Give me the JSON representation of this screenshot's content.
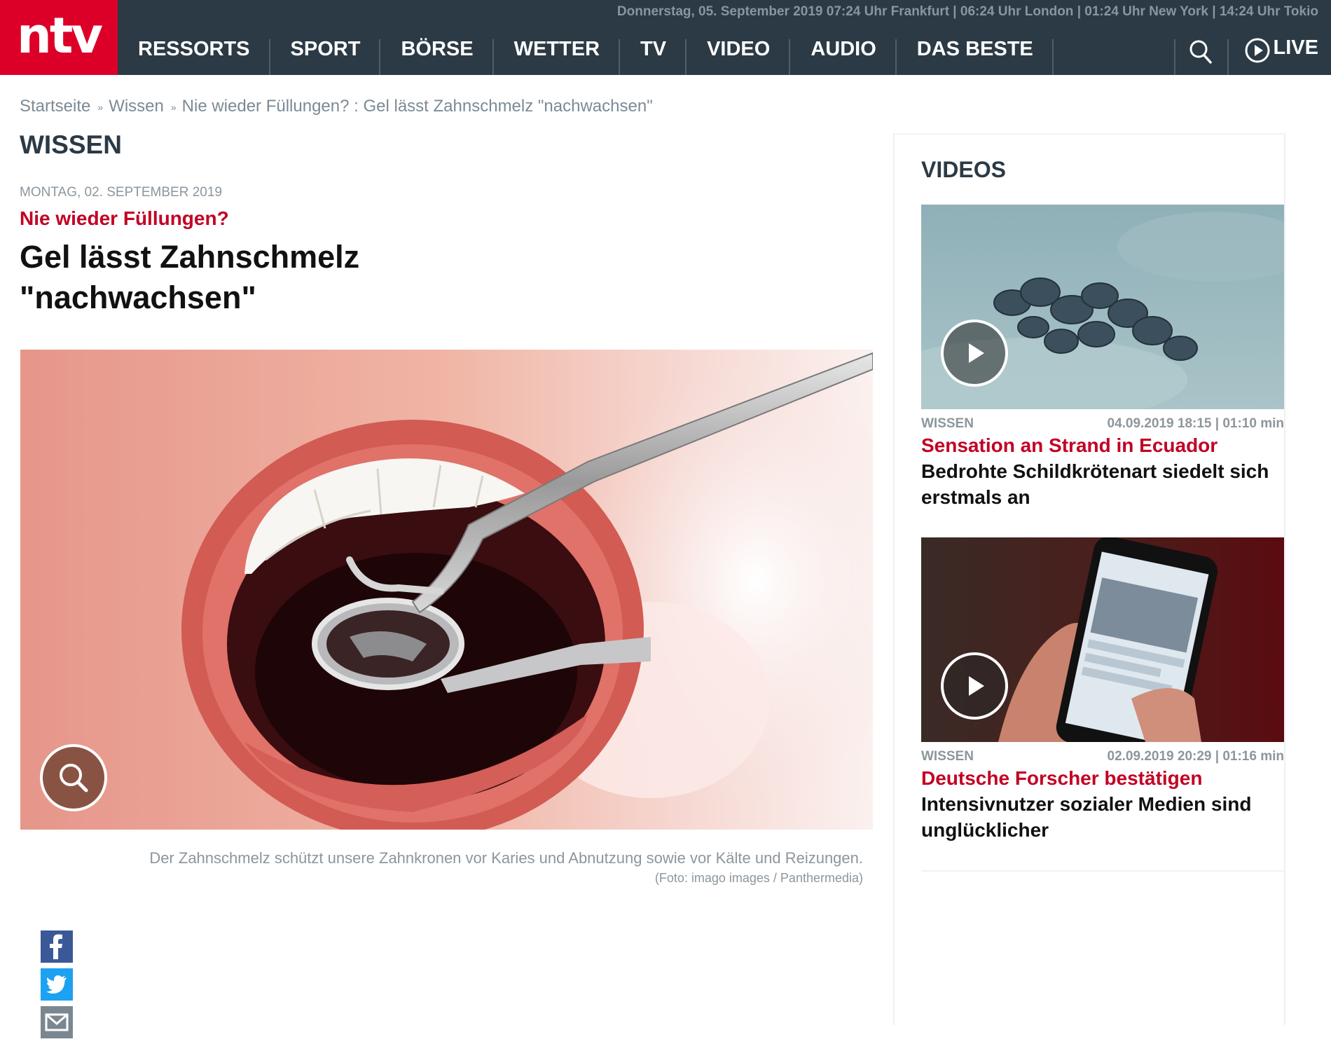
{
  "header": {
    "logo_text": "ntv",
    "topbar_text": "Donnerstag, 05. September 2019  07:24 Uhr Frankfurt | 06:24 Uhr London | 01:24 Uhr New York  | 14:24 Uhr Tokio",
    "nav": [
      {
        "label": "RESSORTS"
      },
      {
        "label": "SPORT"
      },
      {
        "label": "BÖRSE"
      },
      {
        "label": "WETTER"
      },
      {
        "label": "TV"
      },
      {
        "label": "VIDEO"
      },
      {
        "label": "AUDIO"
      },
      {
        "label": "DAS BESTE"
      }
    ],
    "search_icon": "search-icon",
    "live_label": "LIVE",
    "live_icon": "play-circle-icon",
    "brand_color": "#dc0028",
    "bar_color": "#2b3a45"
  },
  "breadcrumb": {
    "items": [
      "Startseite",
      "Wissen",
      "Nie wieder Füllungen? : Gel lässt Zahnschmelz \"nachwachsen\""
    ],
    "separator": "»"
  },
  "article": {
    "section": "WISSEN",
    "date": "Montag, 02. September 2019",
    "kicker": "Nie wieder Füllungen?",
    "headline": "Gel lässt Zahnschmelz \"nachwachsen\"",
    "image_caption": "Der Zahnschmelz schützt unsere Zahnkronen vor Karies und Abnutzung sowie vor Kälte und Reizungen.",
    "image_credit": "(Foto: imago images / Panthermedia)",
    "zoom_icon": "magnifier-icon",
    "share": [
      {
        "network": "facebook",
        "icon": "facebook-icon",
        "color": "#3b5998"
      },
      {
        "network": "twitter",
        "icon": "twitter-icon",
        "color": "#1da1f2"
      },
      {
        "network": "email",
        "icon": "mail-icon",
        "color": "#7b8790"
      }
    ]
  },
  "sidebar": {
    "title": "VIDEOS",
    "videos": [
      {
        "category": "WISSEN",
        "datetime": "04.09.2019 18:15 | 01:10 min",
        "kicker": "Sensation an Strand in Ecuador",
        "title": "Bedrohte Schildkrötenart siedelt sich erstmals an",
        "play_icon": "play-icon"
      },
      {
        "category": "WISSEN",
        "datetime": "02.09.2019 20:29 | 01:16 min",
        "kicker": "Deutsche Forscher bestätigen",
        "title": "Intensivnutzer sozialer Medien sind unglücklicher",
        "play_icon": "play-icon"
      }
    ]
  },
  "colors": {
    "kicker_red": "#c20024",
    "muted_text": "#8c969d"
  }
}
